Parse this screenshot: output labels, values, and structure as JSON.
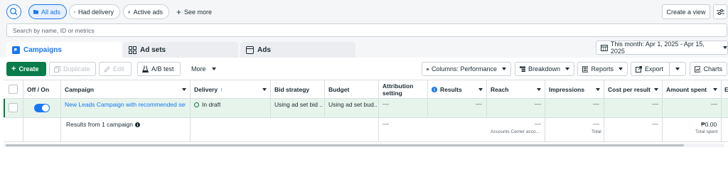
{
  "filters": {
    "all_ads": "All ads",
    "had_delivery": "Had delivery",
    "active_ads": "Active ads",
    "see_more": "See more",
    "create_view": "Create a view"
  },
  "search": {
    "placeholder": "Search by name, ID or metrics"
  },
  "tabs": [
    {
      "label": "Campaigns",
      "icon": "flag-icon",
      "active": true
    },
    {
      "label": "Ad sets",
      "icon": "grid-icon",
      "active": false
    },
    {
      "label": "Ads",
      "icon": "window-icon",
      "active": false
    }
  ],
  "date_range": {
    "label": "This month: Apr 1, 2025 - Apr 15, 2025"
  },
  "toolbar": {
    "create": "Create",
    "duplicate": "Duplicate",
    "edit": "Edit",
    "ab_test": "A/B test",
    "more": "More",
    "columns": "Columns: Performance",
    "breakdown": "Breakdown",
    "reports": "Reports",
    "export": "Export",
    "charts": "Charts"
  },
  "table": {
    "headers": {
      "off_on": "Off / On",
      "campaign": "Campaign",
      "delivery": "Delivery",
      "delivery_sort": "↑",
      "bid_strategy": "Bid strategy",
      "budget": "Budget",
      "attribution_1": "Attribution",
      "attribution_2": "setting",
      "results": "Results",
      "reach": "Reach",
      "impressions": "Impressions",
      "cost_per_result": "Cost per result",
      "amount_spent": "Amount spent",
      "overflow": "E"
    },
    "row": {
      "campaign": "New Leads Campaign with recommended setti...",
      "delivery": "In draft",
      "bid_strategy": "Using ad set bid ...",
      "budget": "Using ad set bud...",
      "attribution": "—",
      "results": "—",
      "reach": "—",
      "impressions": "—",
      "cost_per_result": "—",
      "amount_spent": "—",
      "toggle_on": true
    },
    "summary": {
      "label": "Results from 1 campaign",
      "attribution": "—",
      "reach": "—",
      "reach_sub": "Accounts Center acco...",
      "impressions": "—",
      "impressions_sub": "Total",
      "cost_per_result": "—",
      "amount_spent": "₱0.00",
      "amount_spent_sub": "Total spent"
    }
  },
  "colors": {
    "accent": "#1877f2",
    "create_green": "#0a7b4a",
    "row_highlight": "#e6f4ec",
    "draft_green": "#0a7b4a"
  }
}
